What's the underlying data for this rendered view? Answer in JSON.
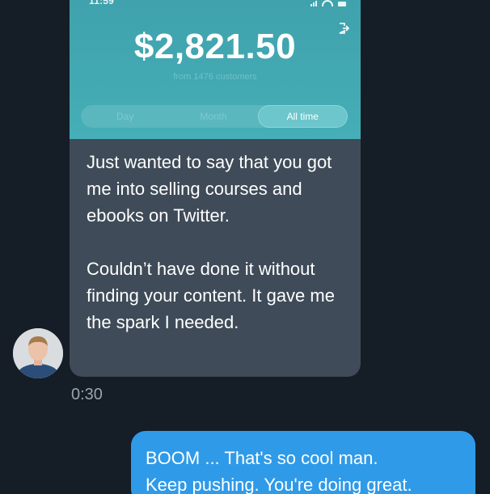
{
  "embedded_screenshot": {
    "status_time": "11:59",
    "revenue_amount": "$2,821.50",
    "revenue_subtitle": "from 1476 customers",
    "segments": [
      "Day",
      "Month",
      "All time"
    ],
    "active_segment": "All time",
    "colors": {
      "card_top": "#3fa2ad",
      "card_bottom": "#45aeb6",
      "segment_bg": "#5ab7be",
      "segment_active": "#6cc6cc"
    }
  },
  "incoming_message": {
    "paragraph1": "Just wanted to say that you got me into selling courses and ebooks on Twitter.",
    "paragraph2": "Couldn’t have done it without finding your content. It gave me the spark I needed.",
    "timestamp": "0:30"
  },
  "outgoing_message": {
    "line1": "BOOM ... That's so cool man.",
    "line2": "Keep pushing. You're doing great."
  },
  "colors": {
    "background": "#151d27",
    "incoming_bubble": "#3f4b58",
    "outgoing_bubble": "#2f9ae8",
    "timestamp": "#9aa4ae"
  }
}
